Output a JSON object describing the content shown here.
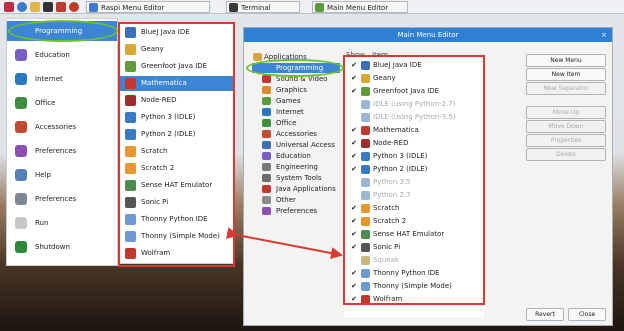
{
  "taskbar": {
    "tasks": [
      {
        "label": "Raspi Menu Editor",
        "icon": "edit-icon",
        "color": "#3b7ad0"
      },
      {
        "label": "Terminal",
        "icon": "terminal-icon",
        "color": "#3a3a3a"
      },
      {
        "label": "Main Menu Editor",
        "icon": "menu-editor-icon",
        "color": "#5a9b3a"
      }
    ]
  },
  "main_menu": {
    "items": [
      {
        "label": "Programming",
        "icon": "code-icon",
        "color": "#3d86d6"
      },
      {
        "label": "Education",
        "icon": "education-icon",
        "color": "#7a5cc7"
      },
      {
        "label": "Internet",
        "icon": "globe-icon",
        "color": "#2b78c2"
      },
      {
        "label": "Office",
        "icon": "office-icon",
        "color": "#3d8f3d"
      },
      {
        "label": "Accessories",
        "icon": "accessories-icon",
        "color": "#c24a2f"
      },
      {
        "label": "Preferences",
        "icon": "preferences-icon",
        "color": "#8a4fb0"
      },
      {
        "label": "Help",
        "icon": "help-icon",
        "color": "#567fb8"
      },
      {
        "label": "Preferences",
        "icon": "settings-icon",
        "color": "#7c8894"
      },
      {
        "label": "Run",
        "icon": "run-icon",
        "color": "#c8c8c8"
      },
      {
        "label": "Shutdown",
        "icon": "shutdown-icon",
        "color": "#2e8a3a"
      }
    ]
  },
  "submenu": {
    "items": [
      {
        "label": "BlueJ Java IDE",
        "icon": "bluej-icon",
        "color": "#3d6fb6"
      },
      {
        "label": "Geany",
        "icon": "geany-icon",
        "color": "#d7a832"
      },
      {
        "label": "Greenfoot Java IDE",
        "icon": "greenfoot-icon",
        "color": "#5e9b3c"
      },
      {
        "label": "Mathematica",
        "icon": "mathematica-icon",
        "color": "#c23a2f"
      },
      {
        "label": "Node-RED",
        "icon": "nodered-icon",
        "color": "#9b2f2f"
      },
      {
        "label": "Python 3 (IDLE)",
        "icon": "python-icon",
        "color": "#3a7bbf"
      },
      {
        "label": "Python 2 (IDLE)",
        "icon": "python-icon",
        "color": "#3a7bbf"
      },
      {
        "label": "Scratch",
        "icon": "scratch-icon",
        "color": "#e5962e"
      },
      {
        "label": "Scratch 2",
        "icon": "scratch-icon",
        "color": "#e5962e"
      },
      {
        "label": "Sense HAT Emulator",
        "icon": "sense-hat-icon",
        "color": "#4f8a4f"
      },
      {
        "label": "Sonic Pi",
        "icon": "sonic-pi-icon",
        "color": "#555555"
      },
      {
        "label": "Thonny Python IDE",
        "icon": "thonny-icon",
        "color": "#6b9bd1"
      },
      {
        "label": "Thonny (Simple Mode)",
        "icon": "thonny-icon",
        "color": "#6b9bd1"
      },
      {
        "label": "Wolfram",
        "icon": "wolfram-icon",
        "color": "#c2372f"
      }
    ]
  },
  "dialog": {
    "title": "Main Menu Editor",
    "close_glyph": "×",
    "col_show": "Show",
    "col_item": "Item",
    "categories": [
      {
        "label": "Applications",
        "icon": "folder-icon",
        "color": "#d8a53a",
        "root": true
      },
      {
        "label": "Programming",
        "icon": "code-icon",
        "color": "#3d86d6"
      },
      {
        "label": "Sound & Video",
        "icon": "sound-icon",
        "color": "#c2372f"
      },
      {
        "label": "Graphics",
        "icon": "graphics-icon",
        "color": "#e08a2e"
      },
      {
        "label": "Games",
        "icon": "games-icon",
        "color": "#5a9b3a"
      },
      {
        "label": "Internet",
        "icon": "globe-icon",
        "color": "#2b78c2"
      },
      {
        "label": "Office",
        "icon": "office-icon",
        "color": "#3d8f3d"
      },
      {
        "label": "Accessories",
        "icon": "accessories-icon",
        "color": "#c24a2f"
      },
      {
        "label": "Universal Access",
        "icon": "access-icon",
        "color": "#3d6fb6"
      },
      {
        "label": "Education",
        "icon": "education-icon",
        "color": "#7a5cc7"
      },
      {
        "label": "Engineering",
        "icon": "engineering-icon",
        "color": "#7a7a7a"
      },
      {
        "label": "System Tools",
        "icon": "system-icon",
        "color": "#6b6b6b"
      },
      {
        "label": "Java Applications",
        "icon": "java-icon",
        "color": "#c2372f"
      },
      {
        "label": "Other",
        "icon": "other-icon",
        "color": "#8a8a8a"
      },
      {
        "label": "Preferences",
        "icon": "preferences-icon",
        "color": "#8a4fb0"
      }
    ],
    "items": [
      {
        "checked": true,
        "label": "BlueJ Java IDE",
        "icon": "bluej-icon",
        "color": "#3d6fb6"
      },
      {
        "checked": true,
        "label": "Geany",
        "icon": "geany-icon",
        "color": "#d7a832"
      },
      {
        "checked": true,
        "label": "Greenfoot Java IDE",
        "icon": "greenfoot-icon",
        "color": "#5e9b3c"
      },
      {
        "checked": false,
        "label": "IDLE (using Python-2.7)",
        "icon": "python-icon",
        "color": "#9bb7d6"
      },
      {
        "checked": false,
        "label": "IDLE (using Python-3.5)",
        "icon": "python-icon",
        "color": "#9bb7d6"
      },
      {
        "checked": true,
        "label": "Mathematica",
        "icon": "mathematica-icon",
        "color": "#c23a2f"
      },
      {
        "checked": true,
        "label": "Node-RED",
        "icon": "nodered-icon",
        "color": "#9b2f2f"
      },
      {
        "checked": true,
        "label": "Python 3 (IDLE)",
        "icon": "python-icon",
        "color": "#3a7bbf"
      },
      {
        "checked": true,
        "label": "Python 2 (IDLE)",
        "icon": "python-icon",
        "color": "#3a7bbf"
      },
      {
        "checked": false,
        "label": "Python 3.5",
        "icon": "python-icon",
        "color": "#9bb7d6"
      },
      {
        "checked": false,
        "label": "Python 2.7",
        "icon": "python-icon",
        "color": "#9bb7d6"
      },
      {
        "checked": true,
        "label": "Scratch",
        "icon": "scratch-icon",
        "color": "#e5962e"
      },
      {
        "checked": true,
        "label": "Scratch 2",
        "icon": "scratch-icon",
        "color": "#e5962e"
      },
      {
        "checked": true,
        "label": "Sense HAT Emulator",
        "icon": "sense-hat-icon",
        "color": "#4f8a4f"
      },
      {
        "checked": true,
        "label": "Sonic Pi",
        "icon": "sonic-pi-icon",
        "color": "#555555"
      },
      {
        "checked": false,
        "label": "Squeak",
        "icon": "squeak-icon",
        "color": "#c8b67a"
      },
      {
        "checked": true,
        "label": "Thonny Python IDE",
        "icon": "thonny-icon",
        "color": "#6b9bd1"
      },
      {
        "checked": true,
        "label": "Thonny (Simple Mode)",
        "icon": "thonny-icon",
        "color": "#6b9bd1"
      },
      {
        "checked": true,
        "label": "Wolfram",
        "icon": "wolfram-icon",
        "color": "#c2372f"
      }
    ],
    "buttons": [
      {
        "label": "New Menu",
        "disabled": false
      },
      {
        "label": "New Item",
        "disabled": false
      },
      {
        "label": "New Separator",
        "disabled": true
      },
      {
        "label": "Move Up",
        "disabled": true
      },
      {
        "label": "Move Down",
        "disabled": true
      },
      {
        "label": "Properties",
        "disabled": true
      },
      {
        "label": "Delete",
        "disabled": true
      }
    ],
    "revert_label": "Revert",
    "close_label": "Close"
  }
}
